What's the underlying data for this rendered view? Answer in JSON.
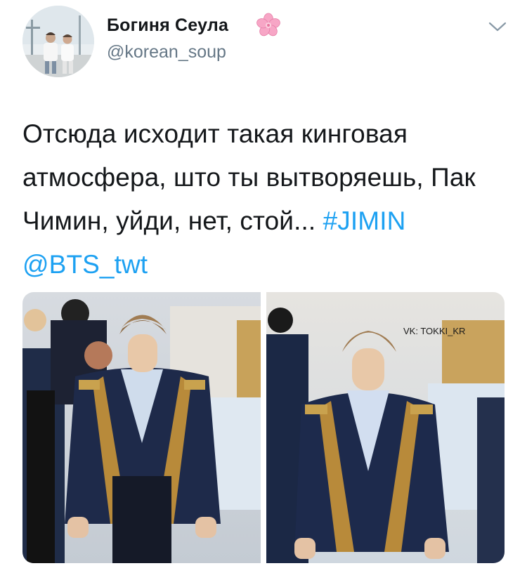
{
  "user": {
    "display_name": "Богиня Сеула",
    "handle": "@korean_soup",
    "name_emoji": "cherry-blossom-icon"
  },
  "tweet": {
    "text": "Отсюда исходит такая кинговая атмосфера, што ты вытворяешь, Пак Чимин, уйди, нет, стой...",
    "hashtag": "#JIMIN",
    "mention": "@BTS_twt"
  },
  "media": {
    "photo_count": 2,
    "watermark": "VK: TOKKI_KR"
  },
  "colors": {
    "link": "#1da1f2",
    "secondary_text": "#657786",
    "primary_text": "#14171a"
  }
}
